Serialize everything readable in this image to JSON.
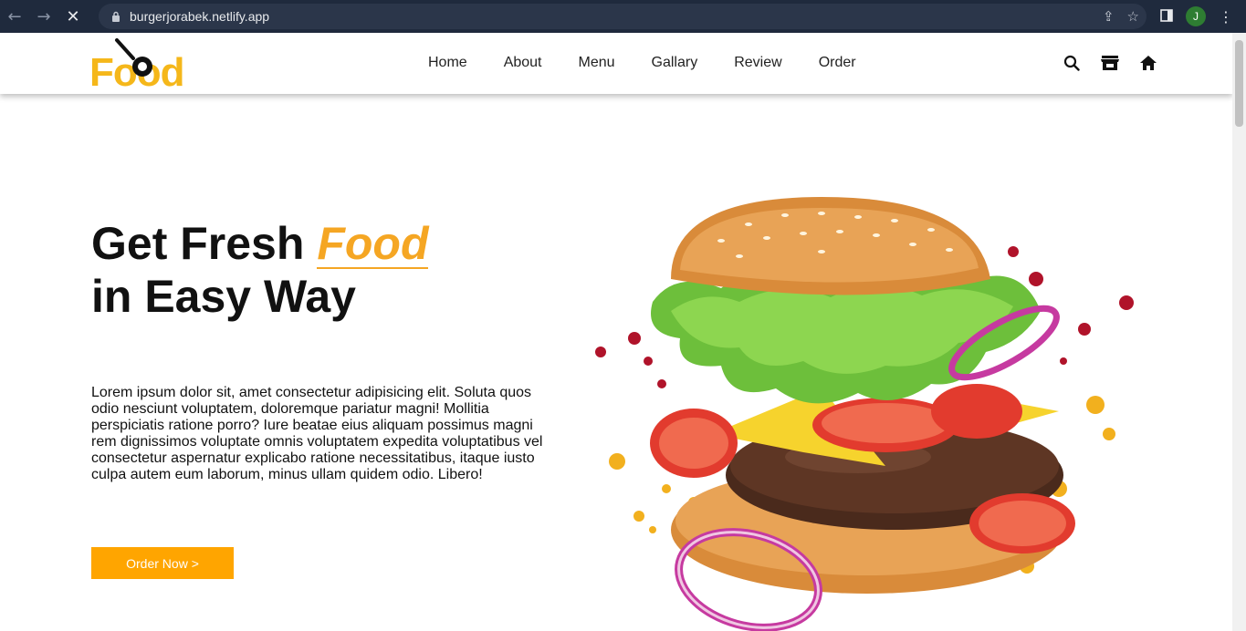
{
  "browser": {
    "url": "burgerjorabek.netlify.app",
    "avatar_initial": "J"
  },
  "site": {
    "logo_text": "Food",
    "nav": [
      "Home",
      "About",
      "Menu",
      "Gallary",
      "Review",
      "Order"
    ],
    "header_icons": [
      "search-icon",
      "store-icon",
      "home-icon"
    ]
  },
  "hero": {
    "title_part1": "Get Fresh",
    "title_accent": "Food",
    "title_line2": "in Easy Way",
    "description": "Lorem ipsum dolor sit, amet consectetur adipisicing elit. Soluta quos odio nesciunt voluptatem, doloremque pariatur magni! Mollitia perspiciatis ratione porro? Iure beatae eius aliquam possimus magni rem dignissimos voluptate omnis voluptatem expedita voluptatibus vel consectetur aspernatur explicabo ratione necessitatibus, itaque iusto culpa autem eum laborum, minus ullam quidem odio. Libero!",
    "button_label": "Order Now >"
  },
  "colors": {
    "accent": "#ffa500",
    "logo": "#f5b71a",
    "chrome_bg": "#1f2a3d"
  }
}
